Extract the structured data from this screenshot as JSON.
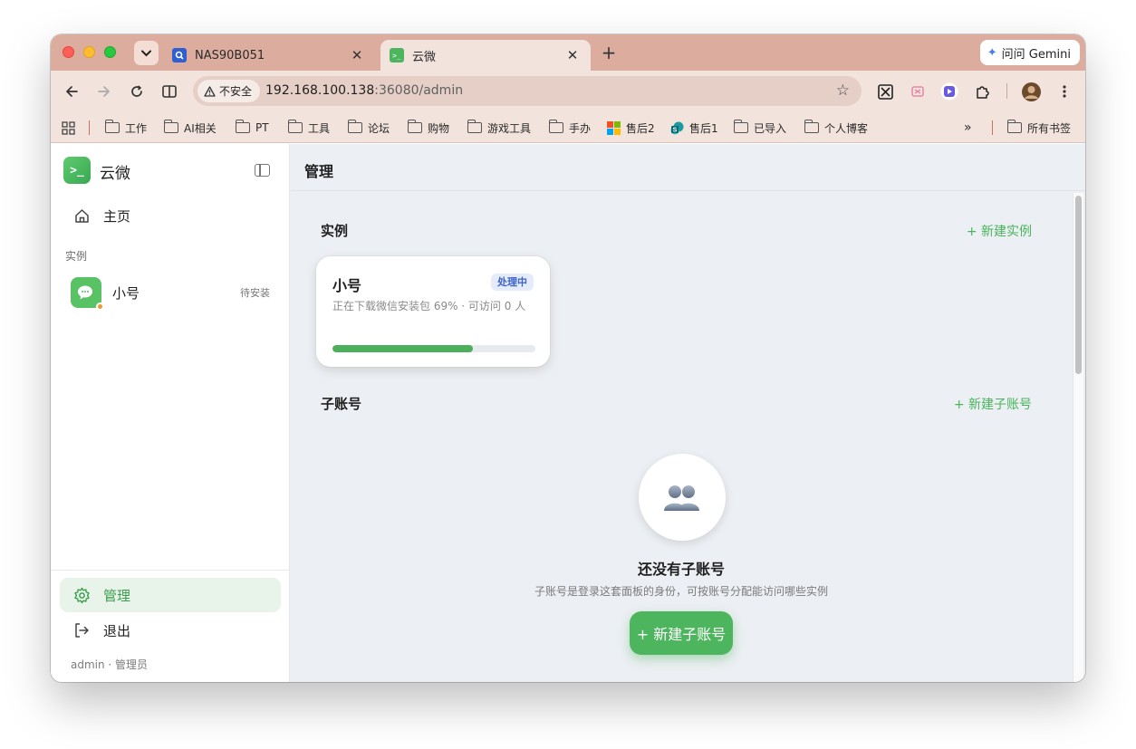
{
  "browser": {
    "tabs": [
      {
        "title": "NAS90B051",
        "active": false
      },
      {
        "title": "云微",
        "active": true
      }
    ],
    "gemini_label": "问问 Gemini",
    "security_label": "不安全",
    "url_host": "192.168.100.138",
    "url_rest": ":36080/admin",
    "bookmarks": [
      "工作",
      "AI相关",
      "PT",
      "工具",
      "论坛",
      "购物",
      "游戏工具",
      "手办",
      "售后2",
      "售后1",
      "已导入",
      "个人博客"
    ],
    "bookmarks_overflow": "»",
    "all_bookmarks": "所有书签"
  },
  "sidebar": {
    "brand": "云微",
    "home": "主页",
    "section_instances": "实例",
    "instance": {
      "name": "小号",
      "status": "待安装"
    },
    "admin": "管理",
    "logout": "退出",
    "user_line": "admin · 管理员"
  },
  "main": {
    "title": "管理",
    "instances": {
      "title": "实例",
      "new_link": "+ 新建实例",
      "card": {
        "name": "小号",
        "badge": "处理中",
        "desc": "正在下载微信安装包 69% · 可访问 0 人",
        "progress": 0.69
      }
    },
    "subaccounts": {
      "title": "子账号",
      "new_link": "+ 新建子账号",
      "empty_title": "还没有子账号",
      "empty_sub": "子账号是登录这套面板的身份，可按账号分配能访问哪些实例",
      "cta": "+ 新建子账号"
    }
  },
  "colors": {
    "accent": "#4cb55d",
    "tabstrip": "#dcad9e",
    "toolbar": "#f2e3dd",
    "badge_bg": "#e4ecfb",
    "badge_text": "#3d62c8",
    "status_dot": "#f0962f"
  }
}
